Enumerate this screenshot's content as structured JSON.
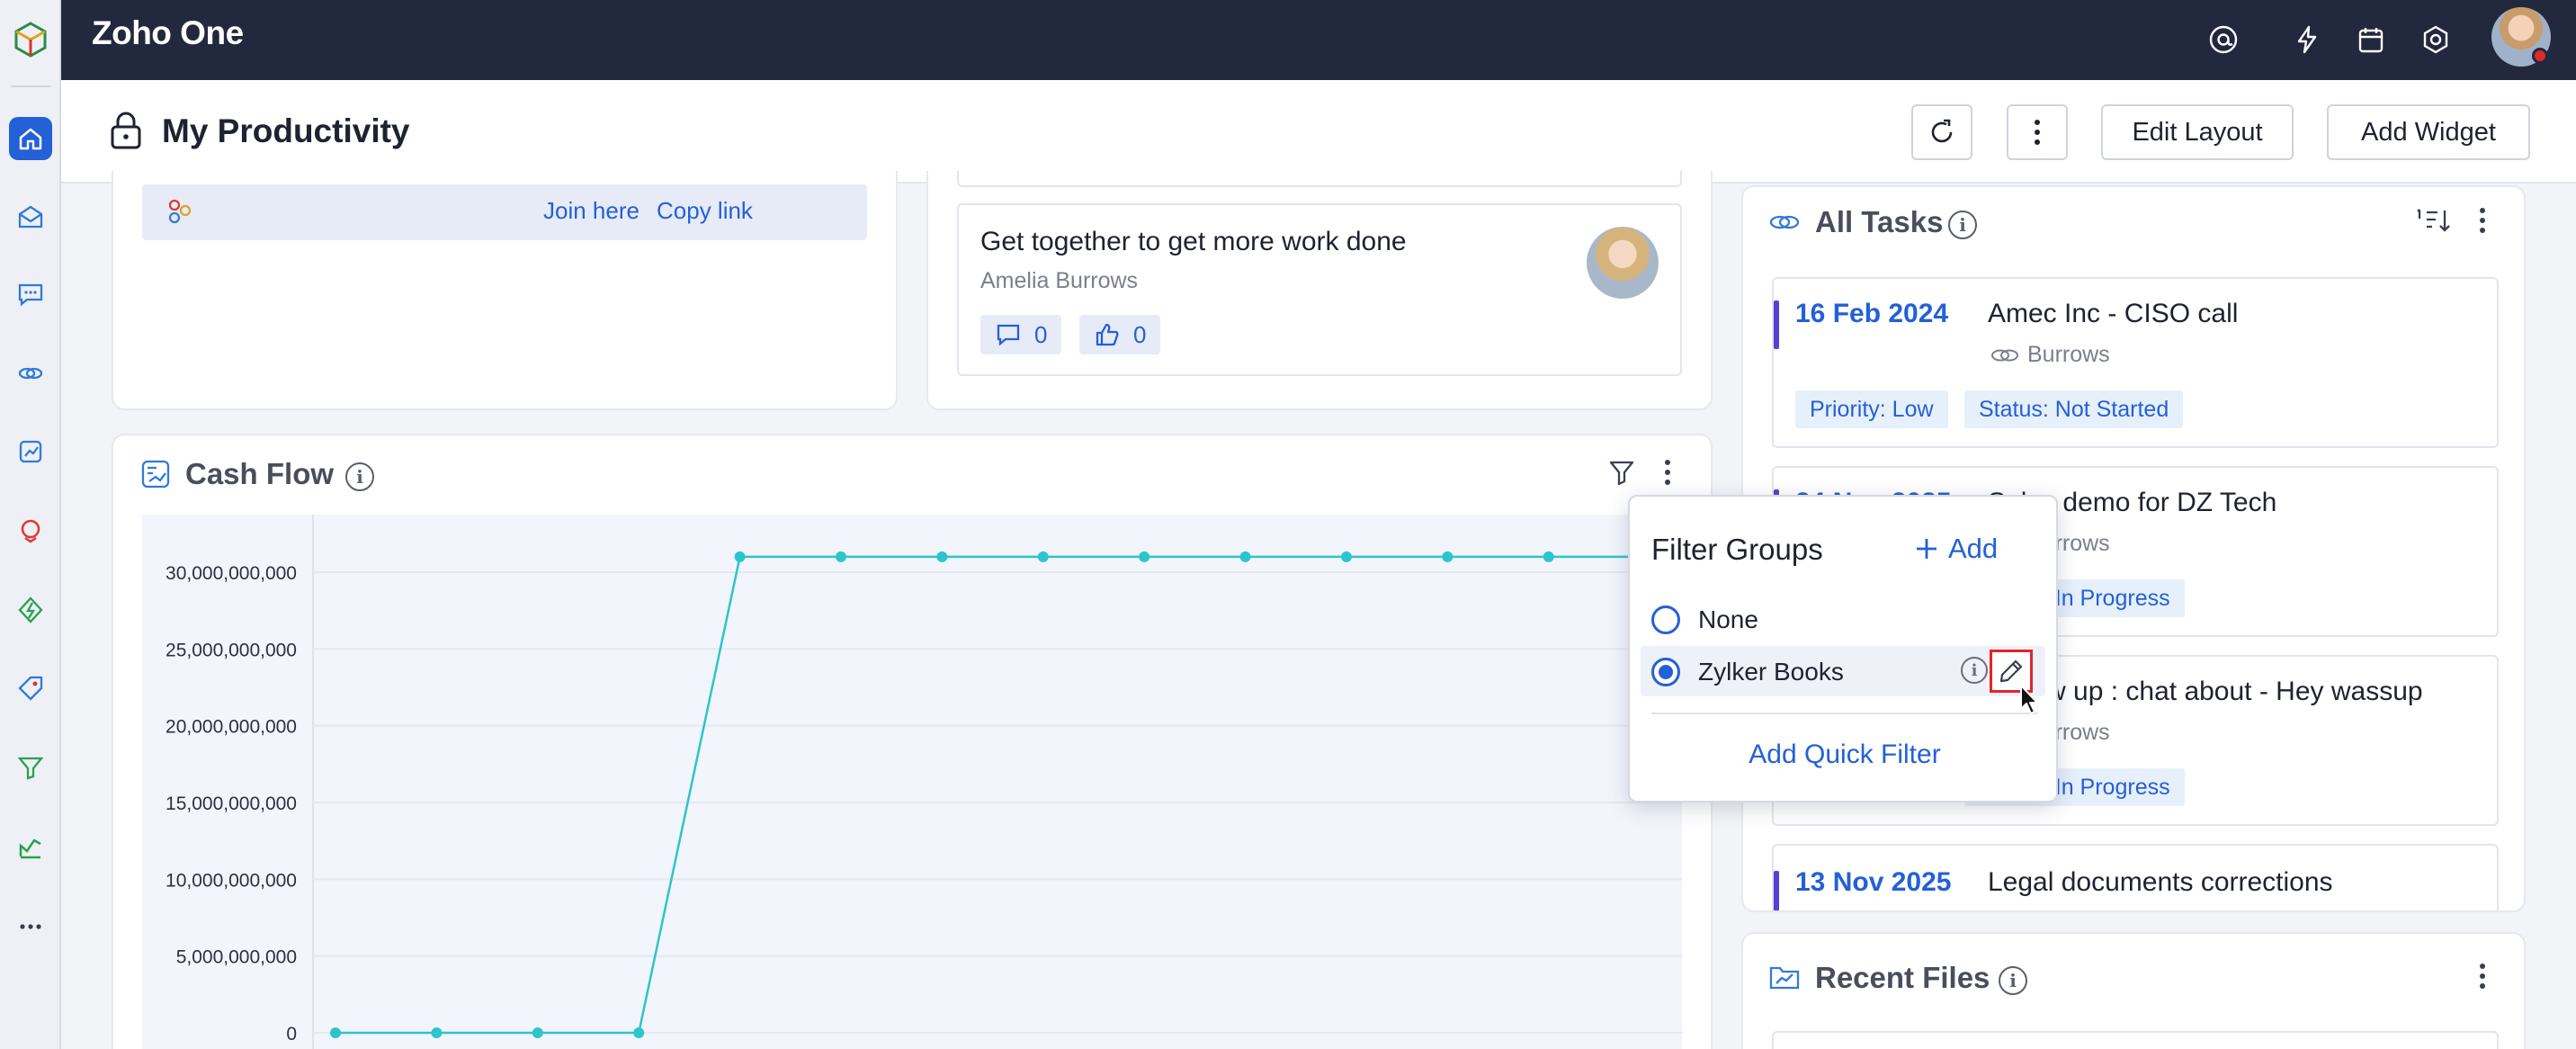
{
  "app": {
    "brand": "Zoho One"
  },
  "header": {
    "title": "My Productivity",
    "edit_layout": "Edit Layout",
    "add_widget": "Add Widget"
  },
  "meeting": {
    "join_label": "Join here",
    "copy_label": "Copy link"
  },
  "post": {
    "title": "Get together to get more work done",
    "author": "Amelia Burrows",
    "comments": "0",
    "likes": "0"
  },
  "cashflow": {
    "title": "Cash Flow"
  },
  "chart_data": {
    "type": "line",
    "title": "Cash Flow",
    "yticks": [
      "30,000,000,000",
      "25,000,000,000",
      "20,000,000,000",
      "15,000,000,000",
      "10,000,000,000",
      "5,000,000,000",
      "0"
    ],
    "ytick_values": [
      30000000000,
      25000000000,
      20000000000,
      15000000000,
      10000000000,
      5000000000,
      0
    ],
    "ylim": [
      0,
      31000000000
    ],
    "series": [
      {
        "values": [
          0,
          0,
          0,
          0,
          31000000000,
          31000000000,
          31000000000,
          31000000000,
          31000000000,
          31000000000,
          31000000000,
          31000000000,
          31000000000,
          31000000000
        ]
      }
    ],
    "color": "#2ec4cc",
    "grid": true
  },
  "tasks": {
    "title": "All Tasks",
    "items": [
      {
        "date": "16 Feb 2024",
        "title": "Amec Inc - CISO call",
        "owner": "Burrows",
        "priority": "Priority: Low",
        "status": "Status: Not Started"
      },
      {
        "date": "24 Nov 2025",
        "title": "Sales demo for DZ Tech",
        "owner": "Burrows",
        "status": "Status: In Progress"
      },
      {
        "date": "",
        "title": "Follow up : chat about - Hey wassup",
        "owner": "Burrows",
        "status": "Status: In Progress"
      },
      {
        "date": "13 Nov 2025",
        "title": "Legal documents corrections"
      }
    ]
  },
  "recent_files": {
    "title": "Recent Files"
  },
  "filter_popup": {
    "title": "Filter Groups",
    "add_label": "Add",
    "options": [
      {
        "label": "None",
        "selected": false
      },
      {
        "label": "Zylker Books",
        "selected": true
      }
    ],
    "quick_filter": "Add Quick Filter"
  },
  "colors": {
    "accent": "#2460d6",
    "topbar": "#22283d",
    "line": "#2ec4cc",
    "highlight": "#e3242b"
  }
}
